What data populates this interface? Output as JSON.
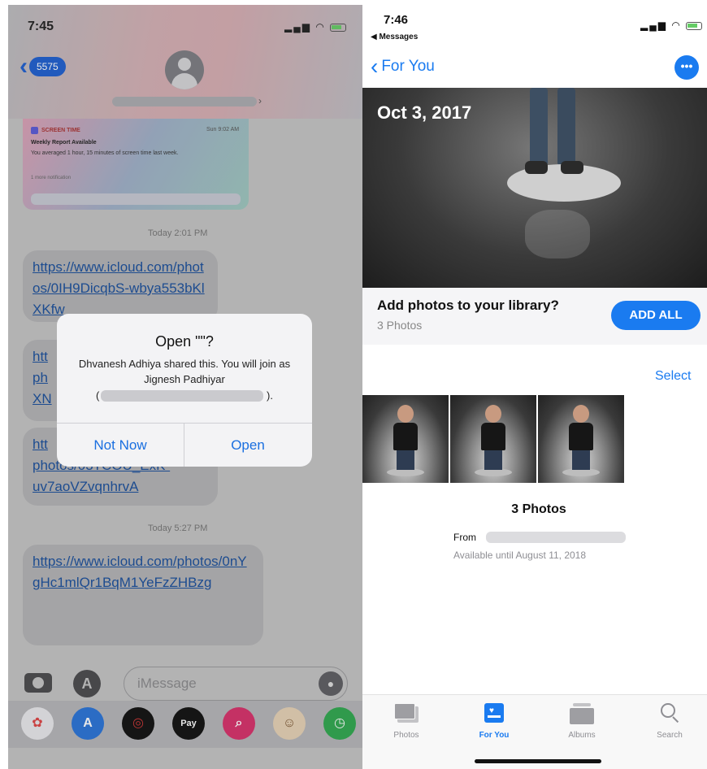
{
  "left": {
    "status_time": "7:45",
    "back_badge": "5575",
    "notification": {
      "app": "SCREEN TIME",
      "time": "Sun 9:02 AM",
      "title": "Weekly Report Available",
      "body": "You averaged 1 hour, 15 minutes of screen time last week.",
      "more": "1 more notification"
    },
    "timestamp1": "Today 2:01 PM",
    "msg1": "https://www.icloud.com/photos/0IH9DicqbS-wbya553bKlXKfw",
    "msg2_visible": [
      "htt",
      "ph",
      "XN"
    ],
    "msg3_visible": "htt",
    "msg3_bottom": [
      "photos/03TCOU_ExK-",
      "uv7aoVZvqnhrvA"
    ],
    "timestamp2": "Today 5:27 PM",
    "msg4": "https://www.icloud.com/photos/0nYgHc1mlQr1BqM1YeFzZHBzg",
    "compose_placeholder": "iMessage",
    "alert": {
      "title": "Open \"\"?",
      "message": "Dhvanesh Adhiya shared this. You will join as Jignesh Padhiyar",
      "paren_open": "(",
      "paren_close": ").",
      "not_now": "Not Now",
      "open": "Open"
    },
    "tray_pay_label": "Pay"
  },
  "right": {
    "status_time": "7:46",
    "status_back": "◀ Messages",
    "nav_back": "For You",
    "more_glyph": "•••",
    "hero_date": "Oct 3, 2017",
    "add_title": "Add photos to your library?",
    "add_sub": "3 Photos",
    "add_all": "ADD ALL",
    "select": "Select",
    "photo_count": "3 Photos",
    "from_label": "From",
    "available": "Available until August 11, 2018",
    "tabs": [
      {
        "label": "Photos"
      },
      {
        "label": "For You"
      },
      {
        "label": "Albums"
      },
      {
        "label": "Search"
      }
    ]
  },
  "colors": {
    "ios_blue": "#1a7bf0",
    "link_blue": "#1a4f9c"
  }
}
